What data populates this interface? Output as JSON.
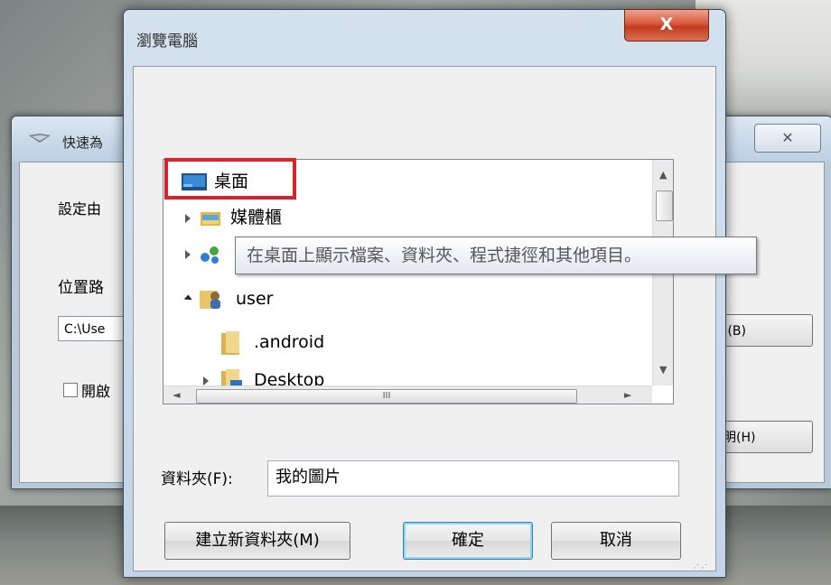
{
  "back_window": {
    "title": "快速為",
    "close_label": "✕",
    "line1": "設定由",
    "path_label": "位置路",
    "path_value": "C:\\Use",
    "checkbox_label": "開啟",
    "browse_label": ".(B)",
    "help_label": "明(H)"
  },
  "dialog": {
    "title": "瀏覽電腦",
    "close_label": "X",
    "tree": {
      "items": [
        {
          "label": "桌面"
        },
        {
          "label": "媒體櫃"
        },
        {
          "label": ""
        },
        {
          "label": "user"
        },
        {
          "label": ".android"
        },
        {
          "label": "Desktop"
        }
      ],
      "hscroll_grip": "III"
    },
    "tooltip": "在桌面上顯示檔案、資料夾、程式捷徑和其他項目。",
    "folder_label": "資料夾(F):",
    "folder_value": "我的圖片",
    "buttons": {
      "new_folder": "建立新資料夾(M)",
      "ok": "確定",
      "cancel": "取消"
    }
  },
  "colors": {
    "highlight": "#e01f2a",
    "close_red": "#c43b1f",
    "window_frame": "#c3d4e6"
  }
}
